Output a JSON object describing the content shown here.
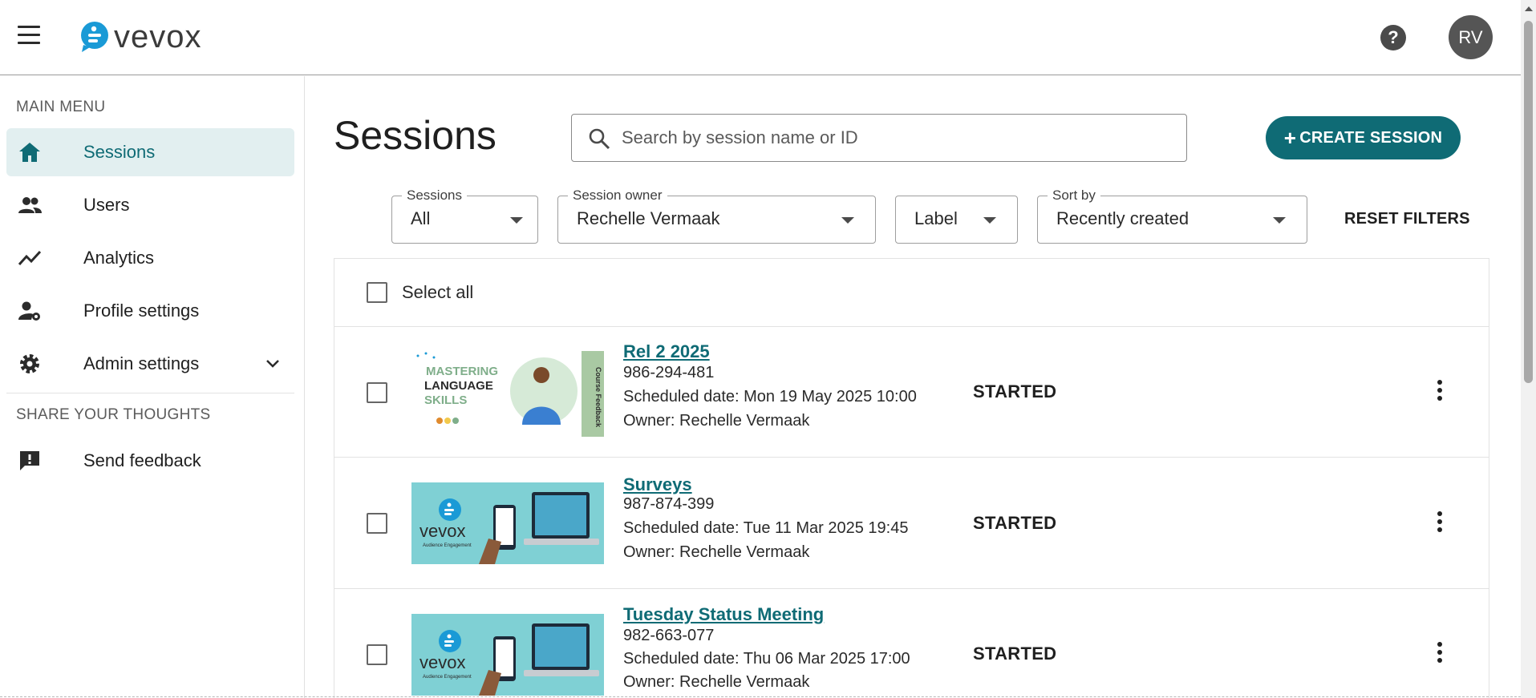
{
  "header": {
    "logo_text": "vevox",
    "help_glyph": "?",
    "avatar_initials": "RV"
  },
  "sidebar": {
    "main_menu_label": "MAIN MENU",
    "items": [
      {
        "label": "Sessions",
        "icon": "home-icon",
        "active": true
      },
      {
        "label": "Users",
        "icon": "users-icon"
      },
      {
        "label": "Analytics",
        "icon": "analytics-icon"
      },
      {
        "label": "Profile settings",
        "icon": "profile-settings-icon"
      },
      {
        "label": "Admin settings",
        "icon": "gear-icon"
      }
    ],
    "share_label": "SHARE YOUR THOUGHTS",
    "feedback_label": "Send feedback"
  },
  "main": {
    "title": "Sessions",
    "search_placeholder": "Search by session name or ID",
    "create_label": "CREATE SESSION",
    "create_plus": "+",
    "filters": {
      "sessions": {
        "legend": "Sessions",
        "value": "All"
      },
      "owner": {
        "legend": "Session owner",
        "value": "Rechelle Vermaak"
      },
      "label": {
        "value": "Label"
      },
      "sort": {
        "legend": "Sort by",
        "value": "Recently created"
      }
    },
    "reset_label": "RESET FILTERS",
    "select_all_label": "Select all",
    "sessions": [
      {
        "name": "Rel 2 2025",
        "id": "986-294-481",
        "scheduled": "Scheduled date: Mon 19 May 2025 10:00",
        "owner": "Owner: Rechelle Vermaak",
        "status": "STARTED",
        "thumb_line1": "MASTERING",
        "thumb_line2": "LANGUAGE",
        "thumb_line3": "SKILLS",
        "thumb_side": "Course Feedback"
      },
      {
        "name": "Surveys",
        "id": "987-874-399",
        "scheduled": "Scheduled date: Tue 11 Mar 2025 19:45",
        "owner": "Owner: Rechelle Vermaak",
        "status": "STARTED",
        "thumb_logo": "vevox",
        "thumb_sub": "Audience Engagement"
      },
      {
        "name": "Tuesday Status Meeting",
        "id": "982-663-077",
        "scheduled": "Scheduled date: Thu 06 Mar 2025 17:00",
        "owner": "Owner: Rechelle Vermaak",
        "status": "STARTED",
        "thumb_logo": "vevox",
        "thumb_sub": "Audience Engagement"
      }
    ]
  },
  "colors": {
    "accent": "#0f6b75",
    "active_bg": "#e2eff0",
    "logo_blue": "#1a9ad6"
  }
}
